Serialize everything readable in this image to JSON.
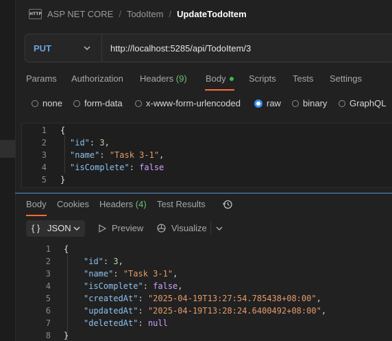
{
  "breadcrumb": {
    "badge": "HTTP",
    "items": [
      "ASP NET CORE",
      "TodoItem",
      "UpdateTodoItem"
    ],
    "separator": "/"
  },
  "request": {
    "method": "PUT",
    "url": "http://localhost:5285/api/TodoItem/3",
    "tabs": [
      {
        "label": "Params"
      },
      {
        "label": "Authorization"
      },
      {
        "label": "Headers",
        "count": "(9)"
      },
      {
        "label": "Body",
        "active": true
      },
      {
        "label": "Scripts"
      },
      {
        "label": "Tests"
      },
      {
        "label": "Settings"
      }
    ],
    "body_types": [
      {
        "label": "none",
        "selected": false
      },
      {
        "label": "form-data",
        "selected": false
      },
      {
        "label": "x-www-form-urlencoded",
        "selected": false
      },
      {
        "label": "raw",
        "selected": true
      },
      {
        "label": "binary",
        "selected": false
      },
      {
        "label": "GraphQL",
        "selected": false
      }
    ],
    "body_lines": [
      {
        "num": "1",
        "text": "{"
      },
      {
        "num": "2",
        "key": "\"id\"",
        "value": "3",
        "comma": ","
      },
      {
        "num": "3",
        "key": "\"name\"",
        "value": "\"Task 3-1\"",
        "comma": ","
      },
      {
        "num": "4",
        "key": "\"isComplete\"",
        "value": "false",
        "comma": ""
      },
      {
        "num": "5",
        "text": "}"
      }
    ]
  },
  "response": {
    "tabs": [
      {
        "label": "Body",
        "active": true
      },
      {
        "label": "Cookies"
      },
      {
        "label": "Headers",
        "count": "(4)"
      },
      {
        "label": "Test Results"
      }
    ],
    "format_braces": "{ }",
    "format": "JSON",
    "preview_label": "Preview",
    "visualize_label": "Visualize",
    "body_lines": [
      {
        "num": "1",
        "text": "{"
      },
      {
        "num": "2",
        "key": "\"id\"",
        "value": "3",
        "comma": ","
      },
      {
        "num": "3",
        "key": "\"name\"",
        "value": "\"Task 3-1\"",
        "comma": ","
      },
      {
        "num": "4",
        "key": "\"isComplete\"",
        "value": "false",
        "comma": ","
      },
      {
        "num": "5",
        "key": "\"createdAt\"",
        "value": "\"2025-04-19T13:27:54.785438+08:00\"",
        "comma": ","
      },
      {
        "num": "6",
        "key": "\"updatedAt\"",
        "value": "\"2025-04-19T13:28:24.6400492+08:00\"",
        "comma": ","
      },
      {
        "num": "7",
        "key": "\"deletedAt\"",
        "value": "null",
        "comma": ""
      },
      {
        "num": "8",
        "text": "}"
      }
    ]
  },
  "colors": {
    "accent": "#ff6c37",
    "method": "#6aa3e6",
    "count": "#6fbf73",
    "radio_selected": "#3a8fef",
    "json_key": "#8cc0ef",
    "json_string": "#e49b6a",
    "json_number": "#b8d7a3",
    "json_keyword": "#d0a0ff"
  }
}
